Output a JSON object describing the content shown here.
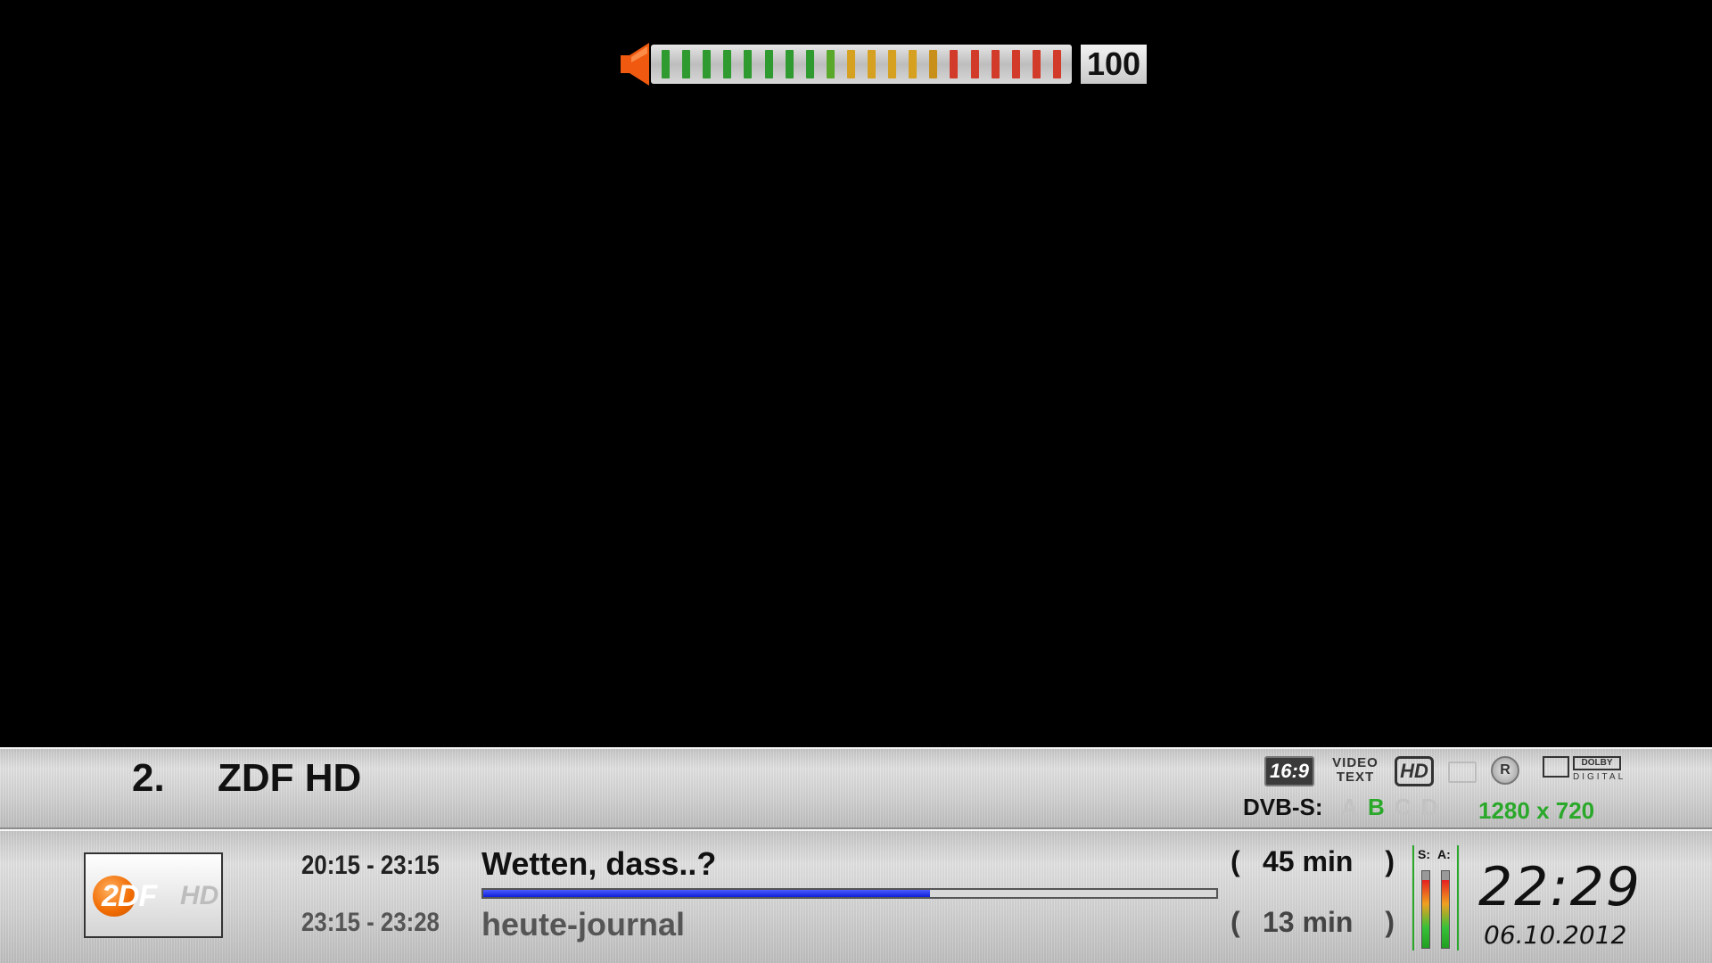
{
  "volume": {
    "level_percent": 100,
    "value": "100",
    "segment_count": 20,
    "segment_colors": [
      "#2f9a2f",
      "#2f9a2f",
      "#2f9a2f",
      "#2f9a2f",
      "#2f9a2f",
      "#2f9a2f",
      "#2f9a2f",
      "#2f9a2f",
      "#5aa82a",
      "#d6a020",
      "#d6a020",
      "#d6a020",
      "#d6a020",
      "#c8901a",
      "#d23a2a",
      "#d23a2a",
      "#d23a2a",
      "#d23a2a",
      "#d23a2a",
      "#d23a2a"
    ],
    "speaker_color": "#f05a10"
  },
  "channel": {
    "number": "2.",
    "name": "ZDF HD"
  },
  "badges": {
    "aspect": "16:9",
    "videotext_line1": "VIDEO",
    "videotext_line2": "TEXT",
    "hd": "HD",
    "record": "R",
    "dolby": "DOLBY",
    "dolby_digital": "DIGITAL"
  },
  "tuner": {
    "label": "DVB-S:",
    "slots": [
      "A",
      "B",
      "C",
      "D"
    ],
    "active": "B",
    "active_color": "#2aa82a"
  },
  "resolution": "1280 x 720",
  "logo": {
    "text": "2DF",
    "hd": "HD"
  },
  "events": {
    "current": {
      "time": "20:15 - 23:15",
      "title": "Wetten, dass..?",
      "remaining_open": "(",
      "remaining": "45 min",
      "remaining_close": ")",
      "progress_percent": 61
    },
    "next": {
      "time": "23:15 - 23:28",
      "title": "heute-journal",
      "duration_open": "(",
      "duration": "13 min",
      "duration_close": ")"
    }
  },
  "signal": {
    "s_label": "S:",
    "a_label": "A:",
    "s_percent": 88,
    "a_percent": 88
  },
  "clock": {
    "time": "22:29",
    "date": "06.10.2012"
  }
}
